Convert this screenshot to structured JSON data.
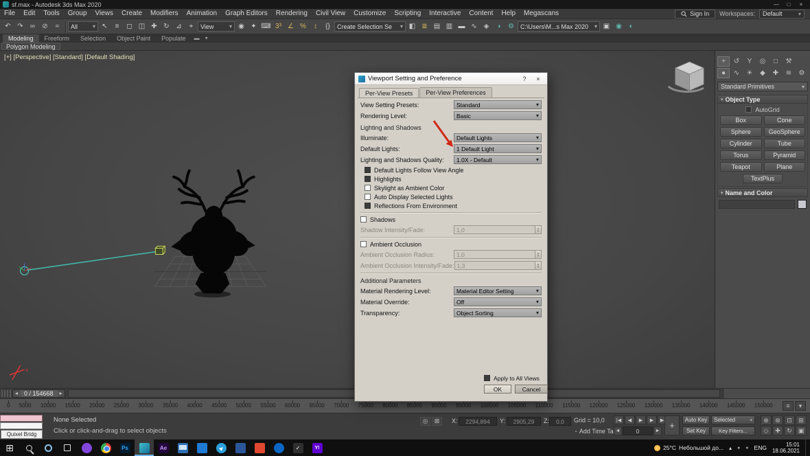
{
  "titlebar": {
    "title": "sf.max - Autodesk 3ds Max 2020",
    "minimize": "—",
    "maximize": "□",
    "close": "×"
  },
  "menubar": {
    "items": [
      "File",
      "Edit",
      "Tools",
      "Group",
      "Views",
      "Create",
      "Modifiers",
      "Animation",
      "Graph Editors",
      "Rendering",
      "Civil View",
      "Customize",
      "Scripting",
      "Interactive",
      "Content",
      "Help",
      "Megascans"
    ],
    "sign_in": "Sign In",
    "workspaces_label": "Workspaces:",
    "workspaces_value": "Default"
  },
  "toolbar": {
    "group1": [
      {
        "name": "undo-icon",
        "glyph": "↶"
      },
      {
        "name": "redo-icon",
        "glyph": "↷"
      },
      {
        "name": "select-and-link-icon",
        "glyph": "∞"
      },
      {
        "name": "unlink-selection-icon",
        "glyph": "⊘"
      },
      {
        "name": "bind-to-space-warp-icon",
        "glyph": "≈"
      }
    ],
    "selection_filter": "All",
    "group2": [
      {
        "name": "select-object-icon",
        "glyph": "↖"
      },
      {
        "name": "select-by-name-icon",
        "glyph": "≡"
      },
      {
        "name": "rectangular-selection-icon",
        "glyph": "◻"
      },
      {
        "name": "window-crossing-icon",
        "glyph": "◫"
      },
      {
        "name": "select-and-move-icon",
        "glyph": "✚"
      },
      {
        "name": "select-and-rotate-icon",
        "glyph": "↻"
      },
      {
        "name": "select-and-scale-icon",
        "glyph": "⊿"
      },
      {
        "name": "select-and-place-icon",
        "glyph": "⌖"
      }
    ],
    "coord_system": "View",
    "group3": [
      {
        "name": "use-pivot-center-icon",
        "glyph": "◉"
      },
      {
        "name": "select-and-manipulate-icon",
        "glyph": "✦"
      },
      {
        "name": "keyboard-override-icon",
        "glyph": "⌨"
      },
      {
        "name": "snaps-toggle-icon",
        "glyph": "3³",
        "color": "#dbb75c"
      },
      {
        "name": "angle-snap-icon",
        "glyph": "∠",
        "color": "#dbb75c"
      },
      {
        "name": "percent-snap-icon",
        "glyph": "%",
        "color": "#dbb75c"
      },
      {
        "name": "spinner-snap-icon",
        "glyph": "↕",
        "color": "#dbb75c"
      },
      {
        "name": "named-selection-sets-icon",
        "glyph": "{}"
      }
    ],
    "selection_set": "Create Selection Se",
    "group4": [
      {
        "name": "mirror-icon",
        "glyph": "◧"
      },
      {
        "name": "align-icon",
        "glyph": "≣",
        "color": "#dbb75c"
      },
      {
        "name": "scene-explorer-icon",
        "glyph": "▤"
      },
      {
        "name": "layer-explorer-icon",
        "glyph": "▥"
      },
      {
        "name": "ribbon-toggle-icon",
        "glyph": "▬"
      },
      {
        "name": "curve-editor-icon",
        "glyph": "∿"
      },
      {
        "name": "schematic-view-icon",
        "glyph": "◈"
      },
      {
        "name": "material-editor-icon",
        "glyph": "◑",
        "color": "#5fb8ae"
      },
      {
        "name": "render-setup-icon",
        "glyph": "⚙",
        "color": "#5fb8ae"
      }
    ],
    "project_path": "C:\\Users\\M...s Max 2020",
    "group5": [
      {
        "name": "rendered-frame-icon",
        "glyph": "▣"
      },
      {
        "name": "render-production-icon",
        "glyph": "◉",
        "color": "#5fb8ae"
      },
      {
        "name": "activeshade-icon",
        "glyph": "◐",
        "color": "#5fb8ae"
      }
    ]
  },
  "ribbon": {
    "tabs": [
      {
        "label": "Modeling",
        "active": true
      },
      {
        "label": "Freeform"
      },
      {
        "label": "Selection"
      },
      {
        "label": "Object Paint"
      },
      {
        "label": "Populate"
      }
    ],
    "extra_icons": [
      {
        "name": "ribbon-minimize-icon",
        "glyph": "▬"
      },
      {
        "name": "ribbon-dropdown-icon",
        "glyph": "▾"
      }
    ],
    "panel_tab": "Polygon Modeling"
  },
  "viewport": {
    "label": "[+] [Perspective] [Standard] [Default Shading]"
  },
  "dialog": {
    "title": "Viewport Setting and Preference",
    "help": "?",
    "close": "×",
    "tabs": [
      {
        "label": "Per-View Presets",
        "active": true
      },
      {
        "label": "Per-View Preferences",
        "active": false
      }
    ],
    "view_setting": {
      "label": "View Setting Presets:",
      "value": "Standard"
    },
    "rendering_level": {
      "label": "Rendering Level:",
      "value": "Basic"
    },
    "lighting_section": "Lighting and Shadows",
    "illuminate": {
      "label": "Illuminate:",
      "value": "Default Lights"
    },
    "default_lights": {
      "label": "Default Lights:",
      "value": "1 Default Light"
    },
    "quality": {
      "label": "Lighting and Shadows Quality:",
      "value": "1.0X - Default"
    },
    "light_checkboxes": [
      {
        "label": "Default Lights Follow View Angle",
        "checked": true
      },
      {
        "label": "Highlights",
        "checked": true
      },
      {
        "label": "Skylight as Ambient Color",
        "checked": false
      },
      {
        "label": "Auto Display Selected Lights",
        "checked": false
      },
      {
        "label": "Reflections From Environment",
        "checked": true
      }
    ],
    "shadows": {
      "label": "Shadows",
      "checked": false
    },
    "shadow_intensity": {
      "label": "Shadow Intensity/Fade:",
      "value": "1,0",
      "disabled": true
    },
    "ambient_occlusion": {
      "label": "Ambient Occlusion",
      "checked": false
    },
    "ao_radius": {
      "label": "Ambient Occlusion Radius:",
      "value": "1,0",
      "disabled": true
    },
    "ao_fade": {
      "label": "Ambient Occlusion Intensity/Fade:",
      "value": "1,3",
      "disabled": true
    },
    "additional_section": "Additional Parameters",
    "material_rendering": {
      "label": "Material Rendering Level:",
      "value": "Material Editor Setting"
    },
    "material_override": {
      "label": "Material Override:",
      "value": "Off"
    },
    "transparency": {
      "label": "Transparency:",
      "value": "Object Sorting"
    },
    "apply_all": {
      "label": "Apply to All Views",
      "checked": true
    },
    "ok": "OK",
    "cancel": "Cancel",
    "arrow_color": "#d02818"
  },
  "command_panel": {
    "panel_tabs": [
      {
        "name": "create-tab-icon",
        "glyph": "+",
        "active": true
      },
      {
        "name": "modify-tab-icon",
        "glyph": "↺"
      },
      {
        "name": "hierarchy-tab-icon",
        "glyph": "Y"
      },
      {
        "name": "motion-tab-icon",
        "glyph": "◎"
      },
      {
        "name": "display-tab-icon",
        "glyph": "□"
      },
      {
        "name": "utilities-tab-icon",
        "glyph": "⚒"
      }
    ],
    "category_icons": [
      {
        "name": "geometry-category-icon",
        "glyph": "●",
        "active": true
      },
      {
        "name": "shapes-category-icon",
        "glyph": "∿"
      },
      {
        "name": "lights-category-icon",
        "glyph": "☀"
      },
      {
        "name": "cameras-category-icon",
        "glyph": "◆"
      },
      {
        "name": "helpers-category-icon",
        "glyph": "✚"
      },
      {
        "name": "spacewarps-category-icon",
        "glyph": "≋"
      },
      {
        "name": "systems-category-icon",
        "glyph": "⚙"
      }
    ],
    "primitives_dropdown": "Standard Primitives",
    "object_type": {
      "title": "Object Type",
      "autogrid": "AutoGrid",
      "buttons": [
        "Box",
        "Cone",
        "Sphere",
        "GeoSphere",
        "Cylinder",
        "Tube",
        "Torus",
        "Pyramid",
        "Teapot",
        "Plane",
        "TextPlus"
      ]
    },
    "name_color_title": "Name and Color"
  },
  "timeline": {
    "prev_glyph": "◄",
    "next_glyph": "►",
    "slider_value": "0 / 154668",
    "ticks": [
      "0",
      "5000",
      "10000",
      "15000",
      "20000",
      "25000",
      "30000",
      "35000",
      "40000",
      "45000",
      "50000",
      "55000",
      "60000",
      "65000",
      "70000",
      "75000",
      "80000",
      "85000",
      "90000",
      "95000",
      "100000",
      "105000",
      "110000",
      "115000",
      "120000",
      "125000",
      "130000",
      "135000",
      "140000",
      "145000",
      "150000"
    ],
    "right_buttons": [
      {
        "name": "timeline-display-icon",
        "glyph": "≡"
      },
      {
        "name": "timeline-options-icon",
        "glyph": "▾"
      }
    ]
  },
  "status_bar": {
    "selection_status": "None Selected",
    "prompt_line": "Click or click-and-drag to select objects",
    "quixel_button": "Quixel Bridg",
    "status_icons": [
      {
        "name": "isolate-selection-icon",
        "glyph": "◎"
      },
      {
        "name": "selection-lock-icon",
        "glyph": "⊠"
      }
    ],
    "x_label": "X:",
    "x_value": "2294,894",
    "y_label": "Y:",
    "y_value": "2905,29",
    "z_label": "Z:",
    "z_value": "0,0",
    "grid_label": "Grid = 10,0",
    "time_tag_icon": "◔",
    "add_time_tag": "Add Time Tag",
    "playback": [
      {
        "name": "go-to-start-button",
        "glyph": "|◀"
      },
      {
        "name": "previous-frame-button",
        "glyph": "◀"
      },
      {
        "name": "play-button",
        "glyph": "▶"
      },
      {
        "name": "next-frame-button",
        "glyph": "▶"
      },
      {
        "name": "go-to-end-button",
        "glyph": "▶|"
      }
    ],
    "frame_prev": "◄",
    "frame_value": "0",
    "frame_next": "►",
    "set_keys_glyph": "+",
    "auto_key": "Auto Key",
    "selected_set": "Selected",
    "set_key": "Set Key",
    "key_filters": "Key Filters...",
    "nav_buttons": [
      {
        "name": "zoom-icon",
        "glyph": "⊕"
      },
      {
        "name": "zoom-all-icon",
        "glyph": "⊛"
      },
      {
        "name": "zoom-extents-icon",
        "glyph": "⊡"
      },
      {
        "name": "zoom-extents-all-icon",
        "glyph": "⊞"
      },
      {
        "name": "field-of-view-icon",
        "glyph": "◇"
      },
      {
        "name": "pan-icon",
        "glyph": "✚"
      },
      {
        "name": "orbit-icon",
        "glyph": "↻"
      },
      {
        "name": "maximize-viewport-icon",
        "glyph": "▣"
      }
    ]
  },
  "taskbar": {
    "apps": [
      {
        "name": "start-button",
        "cls": "ic-start",
        "label": "⊞"
      },
      {
        "name": "search-button",
        "cls": "ic-search",
        "label": ""
      },
      {
        "name": "cortana-button",
        "cls": "ic-cortana",
        "label": ""
      },
      {
        "name": "task-view-button",
        "cls": "ic-taskview",
        "label": ""
      },
      {
        "name": "app-purple-icon",
        "cls": "ic-purple",
        "label": ""
      },
      {
        "name": "chrome-icon",
        "cls": "ic-chrome",
        "label": ""
      },
      {
        "name": "photoshop-icon",
        "cls": "ic-ps",
        "label": "Ps"
      },
      {
        "name": "3dsmax-icon",
        "cls": "ic-max",
        "label": "",
        "active": true
      },
      {
        "name": "after-effects-icon",
        "cls": "ic-ae",
        "label": "Ae"
      },
      {
        "name": "remote-desktop-icon",
        "cls": "ic-monitor",
        "label": ""
      },
      {
        "name": "app-blue-icon",
        "cls": "ic-blue1",
        "label": ""
      },
      {
        "name": "telegram-icon",
        "cls": "ic-telegram",
        "label": "▶"
      },
      {
        "name": "app-blue-2-icon",
        "cls": "ic-blue2",
        "label": ""
      },
      {
        "name": "app-red-icon",
        "cls": "ic-red",
        "label": ""
      },
      {
        "name": "app-blue-3-icon",
        "cls": "ic-blue3",
        "label": ""
      },
      {
        "name": "check-app-icon",
        "cls": "ic-check",
        "label": "✓"
      },
      {
        "name": "yahoo-icon",
        "cls": "ic-yahoo",
        "label": "Y!"
      }
    ],
    "tray": {
      "weather_temp": "25°C",
      "weather_text": "Небольшой до...",
      "chevron": "▴",
      "lang": "ENG",
      "time": "15:01",
      "date": "18.06.2021"
    }
  }
}
